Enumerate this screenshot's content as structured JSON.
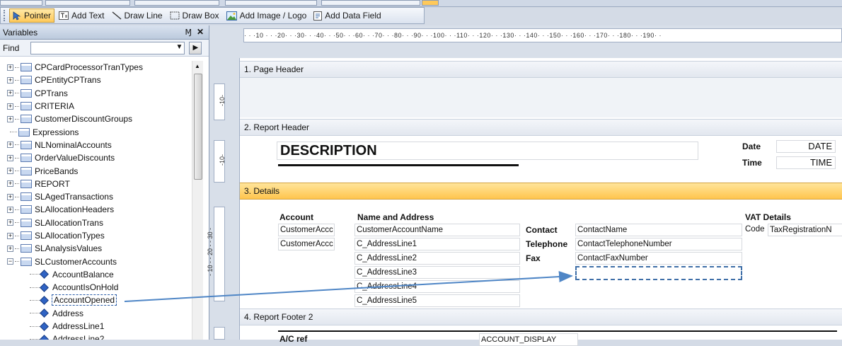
{
  "toolbar": {
    "pointer": "Pointer",
    "add_text": "Add Text",
    "draw_line": "Draw Line",
    "draw_box": "Draw Box",
    "add_image": "Add Image / Logo",
    "add_data_field": "Add Data Field"
  },
  "variables_panel": {
    "title": "Variables",
    "pin": "Ɱ",
    "close": "✕",
    "find_label": "Find",
    "find_value": "",
    "tables": [
      "CPCardProcessorTranTypes",
      "CPEntityCPTrans",
      "CPTrans",
      "CRITERIA",
      "CustomerDiscountGroups",
      "Expressions",
      "NLNominalAccounts",
      "OrderValueDiscounts",
      "PriceBands",
      "REPORT",
      "SLAgedTransactions",
      "SLAllocationHeaders",
      "SLAllocationTrans",
      "SLAllocationTypes",
      "SLAnalysisValues",
      "SLCustomerAccounts"
    ],
    "fields": [
      "AccountBalance",
      "AccountIsOnHold",
      "AccountOpened",
      "Address",
      "AddressLine1",
      "AddressLine2"
    ]
  },
  "ruler": {
    "ticks": "· · ·10 · · ·20· · ·30· · ·40· · ·50· · ·60· · ·70· · ·80· · ·90· · ·100· · ·110· · ·120· · ·130· · ·140· · ·150· · ·160· · ·170· · ·180· · ·190· ·",
    "v1": "-10-",
    "v2": "-10-",
    "v3": "- 10 - - 20 - - 30 -"
  },
  "bands": {
    "page_header": "1. Page Header",
    "report_header": "2. Report Header",
    "details": "3. Details",
    "report_footer": "4. Report Footer 2"
  },
  "report_header": {
    "description": "DESCRIPTION",
    "date_label": "Date",
    "date_field": "DATE",
    "time_label": "Time",
    "time_field": "TIME"
  },
  "details": {
    "account_label": "Account",
    "name_address_label": "Name and Address",
    "vat_label": "VAT Details",
    "cust_acc_1": "CustomerAccc",
    "cust_acc_2": "CustomerAccc",
    "cust_name": "CustomerAccountName",
    "addr1": "C_AddressLine1",
    "addr2": "C_AddressLine2",
    "addr3": "C_AddressLine3",
    "addr4": "C_AddressLine4",
    "addr5": "C_AddressLine5",
    "contact_label": "Contact",
    "telephone_label": "Telephone",
    "fax_label": "Fax",
    "contact_name": "ContactName",
    "contact_tel": "ContactTelephoneNumber",
    "contact_fax": "ContactFaxNumber",
    "code_label": "Code",
    "tax_reg": "TaxRegistrationN"
  },
  "footer": {
    "ac_ref": "A/C ref",
    "account_display": "ACCOUNT_DISPLAY"
  }
}
